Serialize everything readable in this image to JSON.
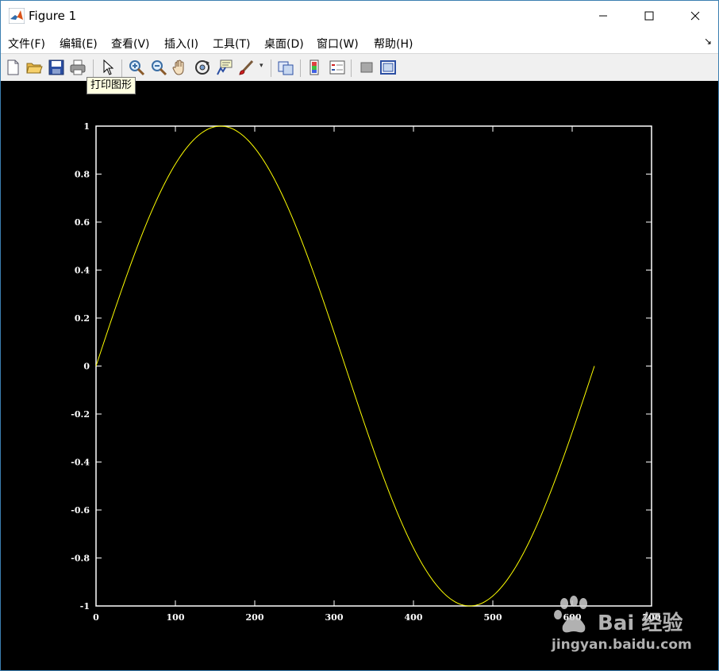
{
  "window": {
    "title": "Figure 1",
    "controls": [
      "minimize",
      "maximize",
      "close"
    ]
  },
  "menubar": {
    "items": [
      {
        "label": "文件(F)"
      },
      {
        "label": "编辑(E)"
      },
      {
        "label": "查看(V)"
      },
      {
        "label": "插入(I)"
      },
      {
        "label": "工具(T)"
      },
      {
        "label": "桌面(D)"
      },
      {
        "label": "窗口(W)"
      },
      {
        "label": "帮助(H)"
      }
    ],
    "overflow_icon": "dock-arrow-icon"
  },
  "toolbar": {
    "tools": [
      "new-figure-icon",
      "open-file-icon",
      "save-icon",
      "print-icon",
      "edit-plot-pointer-icon",
      "zoom-in-icon",
      "zoom-out-icon",
      "pan-hand-icon",
      "rotate-3d-icon",
      "data-cursor-icon",
      "brush-icon",
      "link-plot-icon",
      "insert-colorbar-icon",
      "insert-legend-icon",
      "hide-plot-tools-icon",
      "show-plot-tools-icon"
    ],
    "tooltip": "打印图形"
  },
  "chart_data": {
    "type": "line",
    "series": [
      {
        "function": "sin(2*pi*x/628)",
        "x_range": [
          0,
          628
        ],
        "color": "#ffff00"
      }
    ],
    "xlim": [
      0,
      700
    ],
    "ylim": [
      -1,
      1
    ],
    "xticks": [
      "0",
      "100",
      "200",
      "300",
      "400",
      "500",
      "600",
      "700"
    ],
    "yticks": [
      "-1",
      "-0.8",
      "-0.6",
      "-0.4",
      "-0.2",
      "0",
      "0.2",
      "0.4",
      "0.6",
      "0.8",
      "1"
    ],
    "background": "#000000",
    "axis_color": "#ffffff",
    "grid": false
  },
  "watermark": {
    "brand": "Bai 经验",
    "url": "jingyan.baidu.com"
  }
}
